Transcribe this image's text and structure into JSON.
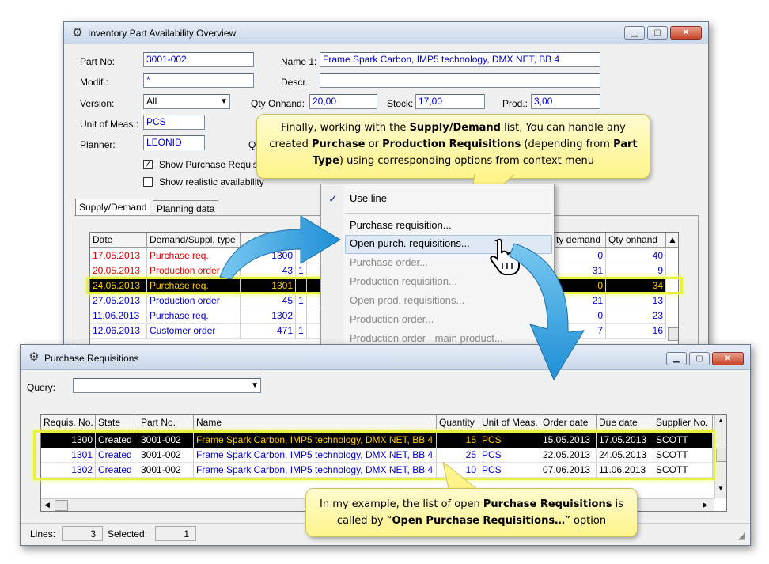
{
  "inventory_window": {
    "title": "Inventory Part Availability Overview",
    "part_no_label": "Part No:",
    "part_no_value": "3001-002",
    "name1_label": "Name 1:",
    "name1_value": "Frame Spark Carbon, IMP5 technology, DMX NET, BB 4",
    "modif_label": "Modif.:",
    "modif_value": "*",
    "descr_label": "Descr.:",
    "descr_value": "",
    "version_label": "Version:",
    "version_value": "All",
    "qty_onhand_label": "Qty Onhand:",
    "qty_onhand_value": "20,00",
    "stock_label": "Stock:",
    "stock_value": "17,00",
    "prod_label": "Prod.:",
    "prod_value": "3,00",
    "unit_label": "Unit of Meas.:",
    "unit_value": "PCS",
    "planner_label": "Planner:",
    "planner_value": "LEONID",
    "qt_partial": "Qt",
    "show_purchase_label": "Show Purchase Requisi",
    "show_purchase_checked": "✓",
    "show_realistic_label": "Show realistic availability",
    "tabs": [
      "Supply/Demand",
      "Planning data"
    ],
    "grid_headers": [
      "Date",
      "Demand/Suppl. type",
      "",
      "",
      "ty demand",
      "Qty onhand"
    ],
    "rows": [
      {
        "date": "17.05.2013",
        "type": "Purchase req.",
        "num": "1300",
        "qty_demand": "0",
        "qty_onhand": "40",
        "color": "red"
      },
      {
        "date": "20.05.2013",
        "type": "Production order",
        "num": "43",
        "extra": "1",
        "qty_demand": "31",
        "qty_onhand": "9",
        "color": "red"
      },
      {
        "date": "24.05.2013",
        "type": "Purchase req.",
        "num": "1301",
        "qty_demand": "0",
        "qty_onhand": "34",
        "color": "sel"
      },
      {
        "date": "27.05.2013",
        "type": "Production order",
        "num": "45",
        "extra": "1",
        "qty_demand": "21",
        "qty_onhand": "13",
        "color": "blue"
      },
      {
        "date": "11.06.2013",
        "type": "Purchase req.",
        "num": "1302",
        "qty_demand": "0",
        "qty_onhand": "23",
        "color": "blue"
      },
      {
        "date": "12.06.2013",
        "type": "Customer order",
        "num": "471",
        "extra": "1",
        "qty_demand": "7",
        "qty_onhand": "16",
        "color": "blue"
      }
    ]
  },
  "context_menu": {
    "check_mark": "✓",
    "items": [
      {
        "label": "Use line",
        "enabled": true
      },
      {
        "label": "Purchase requisition...",
        "enabled": true
      },
      {
        "label": "Open purch. requisitions...",
        "enabled": true
      },
      {
        "label": "Purchase order...",
        "enabled": false
      },
      {
        "label": "Production requisition...",
        "enabled": false
      },
      {
        "label": "Open prod. requisitions...",
        "enabled": false
      },
      {
        "label": "Production order...",
        "enabled": false
      },
      {
        "label": "Production order - main product...",
        "enabled": false
      }
    ]
  },
  "purchase_window": {
    "title": "Purchase Requisitions",
    "query_label": "Query:",
    "query_value": "",
    "headers": [
      "Requis. No.",
      "State",
      "Part No.",
      "Name",
      "Quantity",
      "Unit of Meas.",
      "Order date",
      "Due date",
      "Supplier No."
    ],
    "rows": [
      {
        "requis": "1300",
        "state": "Created",
        "part": "3001-002",
        "name": "Frame Spark Carbon, IMP5 technology, DMX NET, BB 4",
        "qty": "15",
        "unit": "PCS",
        "order": "15.05.2013",
        "due": "17.05.2013",
        "supplier": "SCOTT"
      },
      {
        "requis": "1301",
        "state": "Created",
        "part": "3001-002",
        "name": "Frame Spark Carbon, IMP5 technology, DMX NET, BB 4",
        "qty": "25",
        "unit": "PCS",
        "order": "22.05.2013",
        "due": "24.05.2013",
        "supplier": "SCOTT"
      },
      {
        "requis": "1302",
        "state": "Created",
        "part": "3001-002",
        "name": "Frame Spark Carbon, IMP5 technology, DMX NET, BB 4",
        "qty": "10",
        "unit": "PCS",
        "order": "07.06.2013",
        "due": "11.06.2013",
        "supplier": "SCOTT"
      }
    ],
    "lines_label": "Lines:",
    "lines_value": "3",
    "selected_label": "Selected:",
    "selected_value": "1"
  },
  "callout_top": {
    "p1": "Finally, working with the ",
    "b1": "Supply/Demand",
    "p2": " list, You can handle any created ",
    "b2": "Purchase",
    "p3": " or ",
    "b3": "Production Requisitions",
    "p4": " (depending from ",
    "b4": "Part Type",
    "p5": ") using corresponding options from context menu"
  },
  "callout_bottom": {
    "p1": "In my example, the list of open ",
    "b1": "Purchase Requisitions",
    "p2": " is called by “",
    "b2": "Open Purchase Requisitions…",
    "p3": "” option"
  },
  "colors": {
    "highlight": "#e9f23a",
    "callout": "#fff48a",
    "arrow": "#2ea0e0",
    "selected_row": "#000000"
  }
}
